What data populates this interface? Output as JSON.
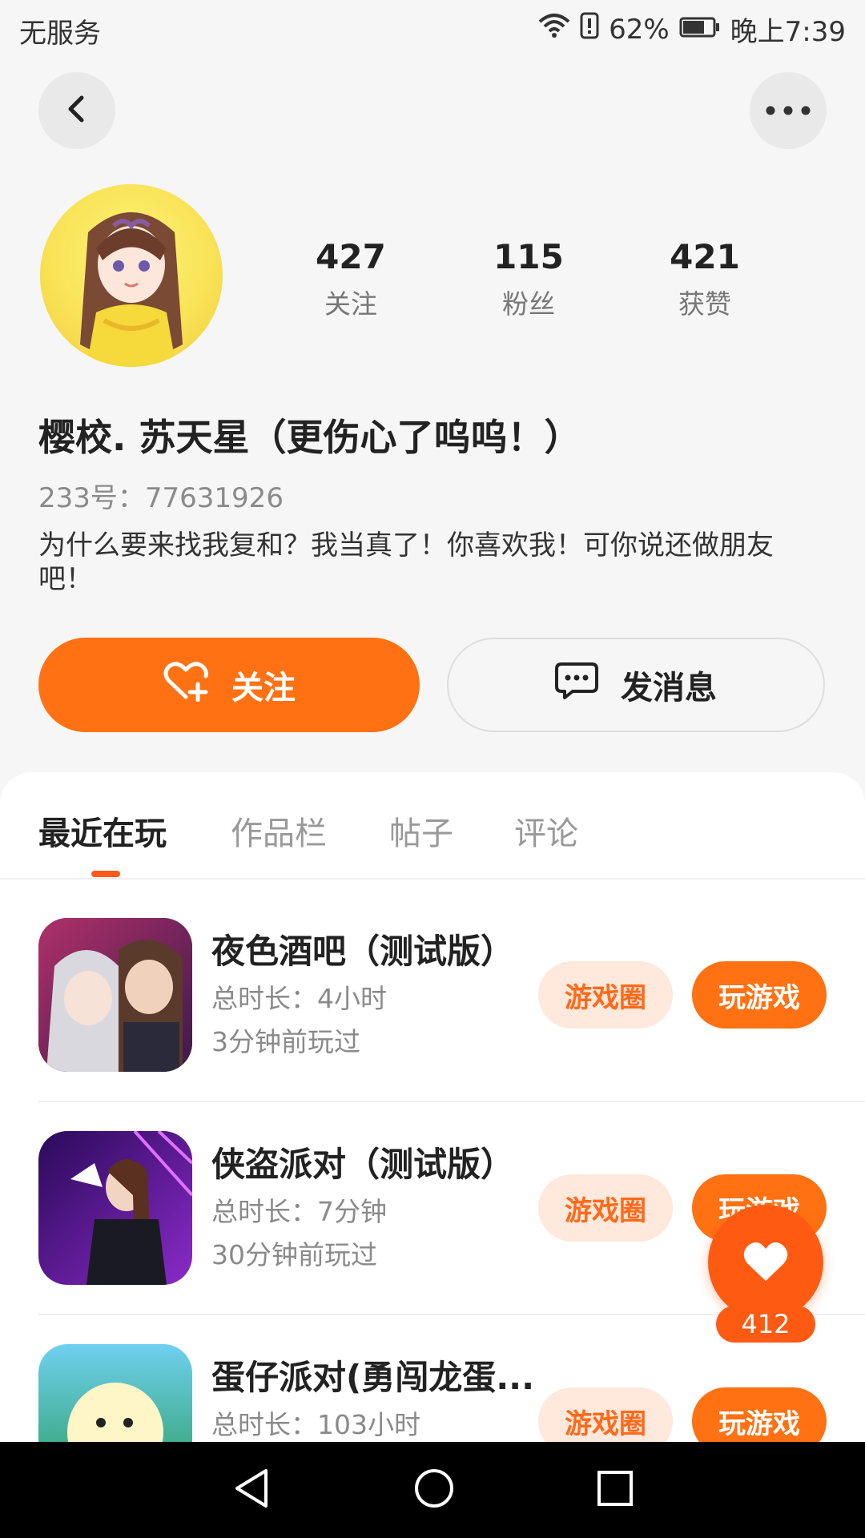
{
  "status_bar": {
    "carrier": "无服务",
    "battery_percent": "62%",
    "time": "晚上7:39",
    "icons": [
      "wifi-icon",
      "alert-icon",
      "battery-icon"
    ]
  },
  "header": {
    "back_icon": "chevron-left-icon",
    "more_icon": "more-horizontal-icon"
  },
  "profile": {
    "stats": [
      {
        "value": "427",
        "label": "关注"
      },
      {
        "value": "115",
        "label": "粉丝"
      },
      {
        "value": "421",
        "label": "获赞"
      }
    ],
    "name": "樱校. 苏天星（更伤心了呜呜！）",
    "id_line": "233号：77631926",
    "bio": "为什么要来找我复和？我当真了！你喜欢我！可你说还做朋友吧！"
  },
  "actions": {
    "follow_label": "关注",
    "message_label": "发消息"
  },
  "tabs": [
    {
      "label": "最近在玩",
      "active": true
    },
    {
      "label": "作品栏",
      "active": false
    },
    {
      "label": "帖子",
      "active": false
    },
    {
      "label": "评论",
      "active": false
    }
  ],
  "games": [
    {
      "title": "夜色酒吧（测试版）",
      "total": "总时长：4小时",
      "last_played": "3分钟前玩过",
      "circle_label": "游戏圈",
      "play_label": "玩游戏"
    },
    {
      "title": "侠盗派对（测试版）",
      "total": "总时长：7分钟",
      "last_played": "30分钟前玩过",
      "circle_label": "游戏圈",
      "play_label": "玩游戏"
    },
    {
      "title": "蛋仔派对(勇闯龙蛋...",
      "total": "总时长：103小时",
      "last_played": "",
      "circle_label": "游戏圈",
      "play_label": "玩游戏"
    }
  ],
  "floating_like": {
    "count": "412"
  },
  "colors": {
    "accent": "#ff7112",
    "accent_light": "#ffe8dc",
    "background": "#f6f6f6"
  }
}
